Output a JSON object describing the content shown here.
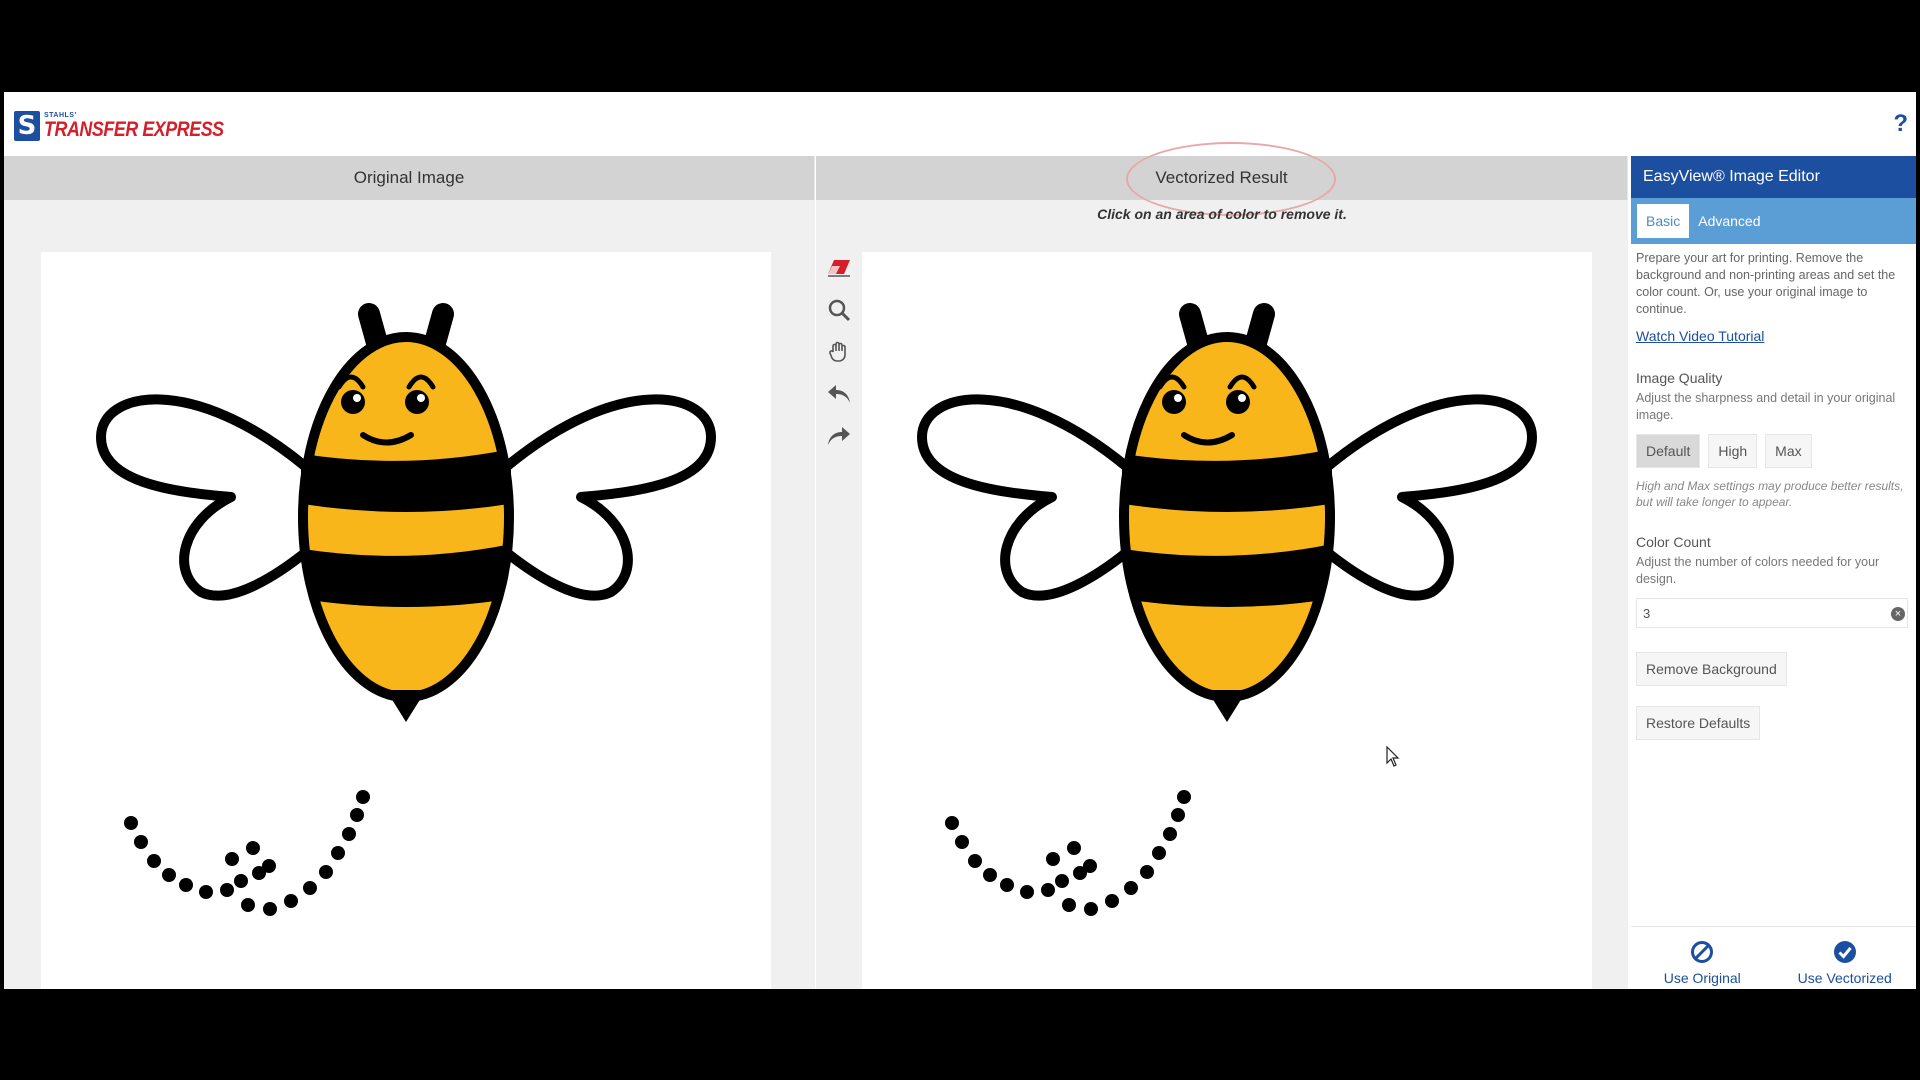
{
  "header": {
    "logo_small": "STAHLS'",
    "logo_big": "TRANSFER EXPRESS",
    "help_label": "?"
  },
  "left_panel": {
    "title": "Original Image"
  },
  "right_panel": {
    "title": "Vectorized Result",
    "hint": "Click on an area of color to remove it."
  },
  "tools": [
    "eraser-icon",
    "zoom-icon",
    "hand-icon",
    "undo-icon",
    "redo-icon"
  ],
  "sidebar": {
    "title": "EasyView® Image Editor",
    "tabs": [
      {
        "label": "Basic",
        "active": true
      },
      {
        "label": "Advanced",
        "active": false
      }
    ],
    "intro": "Prepare your art for printing. Remove the background and non-printing areas and set the color count. Or, use your original image to continue.",
    "tutorial_link": "Watch Video Tutorial",
    "quality": {
      "label": "Image Quality",
      "description": "Adjust the sharpness and detail in your original image.",
      "options": [
        "Default",
        "High",
        "Max"
      ],
      "selected": "Default",
      "note": "High and Max settings may produce better results, but will take longer to appear."
    },
    "color_count": {
      "label": "Color Count",
      "description": "Adjust the number of colors needed for your design.",
      "value": "3"
    },
    "remove_background": "Remove Background",
    "restore_defaults": "Restore Defaults",
    "footer": {
      "use_original": "Use Original",
      "use_vectorized": "Use Vectorized"
    }
  },
  "colors": {
    "brand_blue": "#1c4fa0",
    "brand_red": "#d41f2b",
    "tab_bar": "#5b9ed6",
    "bee_yellow": "#f9b61a",
    "highlight_ring": "#e8a7ad"
  }
}
